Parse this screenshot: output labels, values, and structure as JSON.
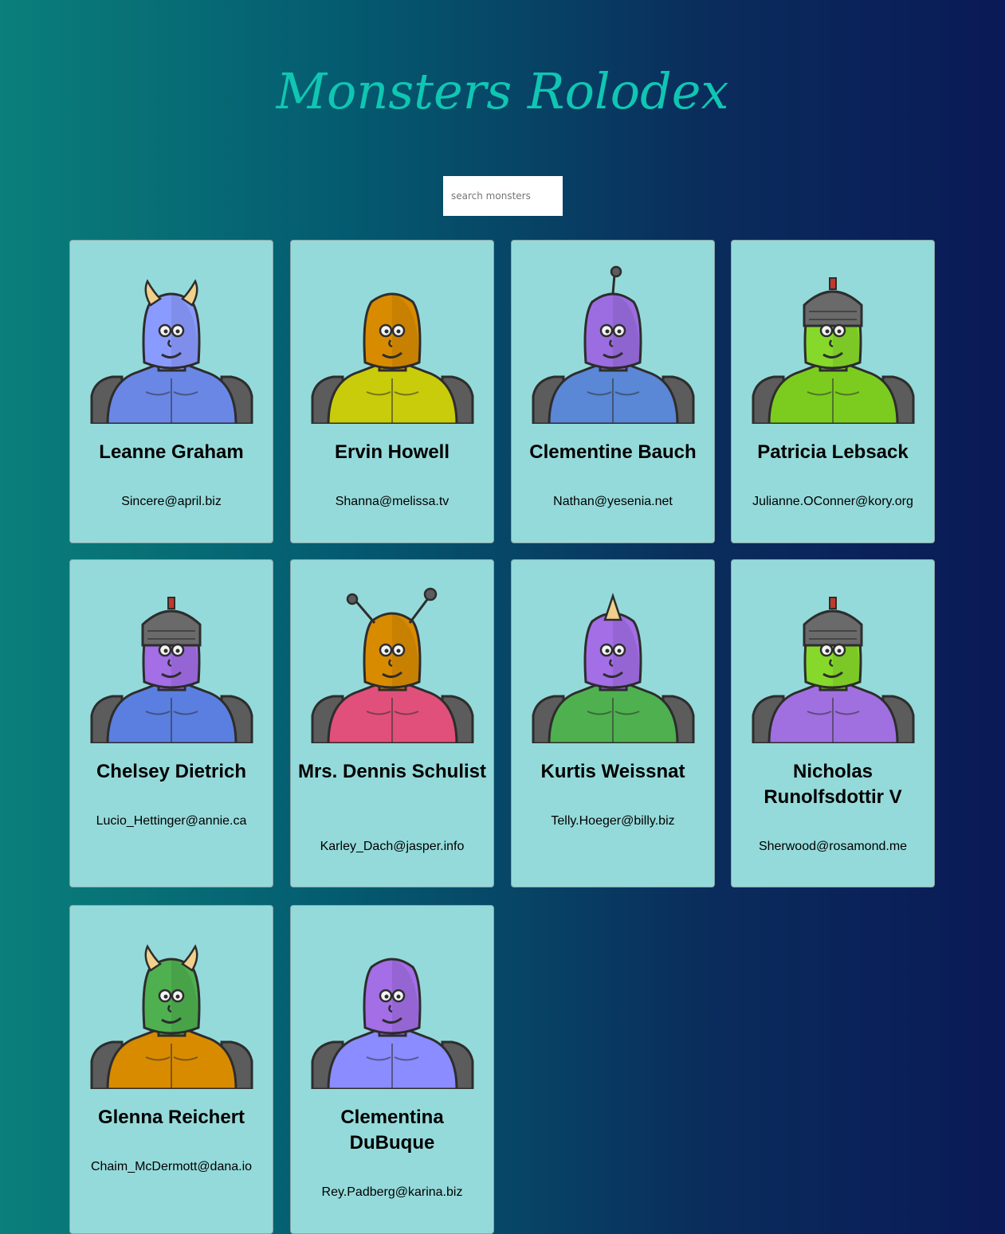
{
  "app": {
    "title": "Monsters Rolodex"
  },
  "search": {
    "placeholder": "search monsters",
    "value": ""
  },
  "monsters": [
    {
      "name": "Leanne Graham",
      "email": "Sincere@april.biz",
      "skin": "#8a9bff",
      "body": "#6a87e6",
      "horns": "horns"
    },
    {
      "name": "Ervin Howell",
      "email": "Shanna@melissa.tv",
      "skin": "#d98b00",
      "body": "#c9cc0a",
      "horns": "none"
    },
    {
      "name": "Clementine Bauch",
      "email": "Nathan@yesenia.net",
      "skin": "#9b6de0",
      "body": "#5a87d6",
      "horns": "antenna"
    },
    {
      "name": "Patricia Lebsack",
      "email": "Julianne.OConner@kory.org",
      "skin": "#86d92a",
      "body": "#7ccc1f",
      "horns": "helmet"
    },
    {
      "name": "Chelsey Dietrich",
      "email": "Lucio_Hettinger@annie.ca",
      "skin": "#a36ee6",
      "body": "#5a7fe0",
      "horns": "helmet"
    },
    {
      "name": "Mrs. Dennis Schulist",
      "email": "Karley_Dach@jasper.info",
      "skin": "#d98b00",
      "body": "#e0507a",
      "horns": "antennae"
    },
    {
      "name": "Kurtis Weissnat",
      "email": "Telly.Hoeger@billy.biz",
      "skin": "#a36ee6",
      "body": "#4fb04f",
      "horns": "horn"
    },
    {
      "name": "Nicholas Runolfsdottir V",
      "email": "Sherwood@rosamond.me",
      "skin": "#86d92a",
      "body": "#a070e0",
      "horns": "helmet"
    },
    {
      "name": "Glenna Reichert",
      "email": "Chaim_McDermott@dana.io",
      "skin": "#4fb04f",
      "body": "#d98b00",
      "horns": "horns"
    },
    {
      "name": "Clementina DuBuque",
      "email": "Rey.Padberg@karina.biz",
      "skin": "#a36ee6",
      "body": "#8a8cff",
      "horns": "none"
    }
  ]
}
